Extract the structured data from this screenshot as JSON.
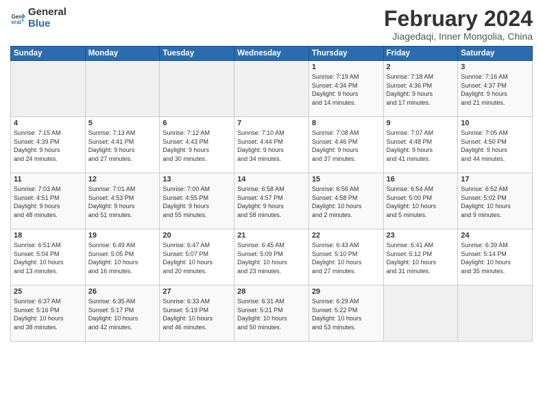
{
  "logo": {
    "line1": "General",
    "line2": "Blue"
  },
  "calendar": {
    "title": "February 2024",
    "subtitle": "Jiagedaqi, Inner Mongolia, China"
  },
  "headers": [
    "Sunday",
    "Monday",
    "Tuesday",
    "Wednesday",
    "Thursday",
    "Friday",
    "Saturday"
  ],
  "weeks": [
    [
      {
        "day": "",
        "info": ""
      },
      {
        "day": "",
        "info": ""
      },
      {
        "day": "",
        "info": ""
      },
      {
        "day": "",
        "info": ""
      },
      {
        "day": "1",
        "info": "Sunrise: 7:19 AM\nSunset: 4:34 PM\nDaylight: 9 hours\nand 14 minutes."
      },
      {
        "day": "2",
        "info": "Sunrise: 7:18 AM\nSunset: 4:36 PM\nDaylight: 9 hours\nand 17 minutes."
      },
      {
        "day": "3",
        "info": "Sunrise: 7:16 AM\nSunset: 4:37 PM\nDaylight: 9 hours\nand 21 minutes."
      }
    ],
    [
      {
        "day": "4",
        "info": "Sunrise: 7:15 AM\nSunset: 4:39 PM\nDaylight: 9 hours\nand 24 minutes."
      },
      {
        "day": "5",
        "info": "Sunrise: 7:13 AM\nSunset: 4:41 PM\nDaylight: 9 hours\nand 27 minutes."
      },
      {
        "day": "6",
        "info": "Sunrise: 7:12 AM\nSunset: 4:43 PM\nDaylight: 9 hours\nand 30 minutes."
      },
      {
        "day": "7",
        "info": "Sunrise: 7:10 AM\nSunset: 4:44 PM\nDaylight: 9 hours\nand 34 minutes."
      },
      {
        "day": "8",
        "info": "Sunrise: 7:08 AM\nSunset: 4:46 PM\nDaylight: 9 hours\nand 37 minutes."
      },
      {
        "day": "9",
        "info": "Sunrise: 7:07 AM\nSunset: 4:48 PM\nDaylight: 9 hours\nand 41 minutes."
      },
      {
        "day": "10",
        "info": "Sunrise: 7:05 AM\nSunset: 4:50 PM\nDaylight: 9 hours\nand 44 minutes."
      }
    ],
    [
      {
        "day": "11",
        "info": "Sunrise: 7:03 AM\nSunset: 4:51 PM\nDaylight: 9 hours\nand 48 minutes."
      },
      {
        "day": "12",
        "info": "Sunrise: 7:01 AM\nSunset: 4:53 PM\nDaylight: 9 hours\nand 51 minutes."
      },
      {
        "day": "13",
        "info": "Sunrise: 7:00 AM\nSunset: 4:55 PM\nDaylight: 9 hours\nand 55 minutes."
      },
      {
        "day": "14",
        "info": "Sunrise: 6:58 AM\nSunset: 4:57 PM\nDaylight: 9 hours\nand 58 minutes."
      },
      {
        "day": "15",
        "info": "Sunrise: 6:56 AM\nSunset: 4:58 PM\nDaylight: 10 hours\nand 2 minutes."
      },
      {
        "day": "16",
        "info": "Sunrise: 6:54 AM\nSunset: 5:00 PM\nDaylight: 10 hours\nand 5 minutes."
      },
      {
        "day": "17",
        "info": "Sunrise: 6:52 AM\nSunset: 5:02 PM\nDaylight: 10 hours\nand 9 minutes."
      }
    ],
    [
      {
        "day": "18",
        "info": "Sunrise: 6:51 AM\nSunset: 5:04 PM\nDaylight: 10 hours\nand 13 minutes."
      },
      {
        "day": "19",
        "info": "Sunrise: 6:49 AM\nSunset: 5:05 PM\nDaylight: 10 hours\nand 16 minutes."
      },
      {
        "day": "20",
        "info": "Sunrise: 6:47 AM\nSunset: 5:07 PM\nDaylight: 10 hours\nand 20 minutes."
      },
      {
        "day": "21",
        "info": "Sunrise: 6:45 AM\nSunset: 5:09 PM\nDaylight: 10 hours\nand 23 minutes."
      },
      {
        "day": "22",
        "info": "Sunrise: 6:43 AM\nSunset: 5:10 PM\nDaylight: 10 hours\nand 27 minutes."
      },
      {
        "day": "23",
        "info": "Sunrise: 6:41 AM\nSunset: 5:12 PM\nDaylight: 10 hours\nand 31 minutes."
      },
      {
        "day": "24",
        "info": "Sunrise: 6:39 AM\nSunset: 5:14 PM\nDaylight: 10 hours\nand 35 minutes."
      }
    ],
    [
      {
        "day": "25",
        "info": "Sunrise: 6:37 AM\nSunset: 5:16 PM\nDaylight: 10 hours\nand 38 minutes."
      },
      {
        "day": "26",
        "info": "Sunrise: 6:35 AM\nSunset: 5:17 PM\nDaylight: 10 hours\nand 42 minutes."
      },
      {
        "day": "27",
        "info": "Sunrise: 6:33 AM\nSunset: 5:19 PM\nDaylight: 10 hours\nand 46 minutes."
      },
      {
        "day": "28",
        "info": "Sunrise: 6:31 AM\nSunset: 5:21 PM\nDaylight: 10 hours\nand 50 minutes."
      },
      {
        "day": "29",
        "info": "Sunrise: 6:29 AM\nSunset: 5:22 PM\nDaylight: 10 hours\nand 53 minutes."
      },
      {
        "day": "",
        "info": ""
      },
      {
        "day": "",
        "info": ""
      }
    ]
  ]
}
